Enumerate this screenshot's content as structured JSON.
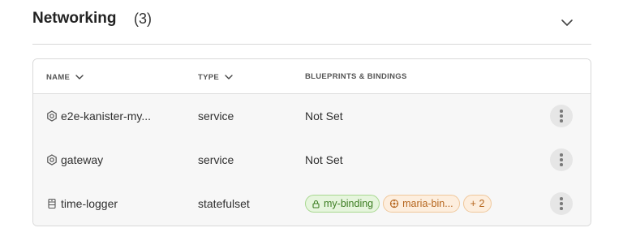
{
  "section": {
    "title": "Networking",
    "count": "(3)"
  },
  "table": {
    "columns": {
      "name": "NAME",
      "type": "TYPE",
      "blueprints": "BLUEPRINTS & BINDINGS"
    },
    "rows": [
      {
        "name": "e2e-kanister-my...",
        "type": "service",
        "blueprints": "Not Set",
        "icon": "service-icon"
      },
      {
        "name": "gateway",
        "type": "service",
        "blueprints": "Not Set",
        "icon": "service-icon"
      },
      {
        "name": "time-logger",
        "type": "statefulset",
        "icon": "statefulset-icon",
        "tags": [
          {
            "label": "my-binding",
            "icon": "lock-icon"
          },
          {
            "label": "maria-bin...",
            "icon": "blueprint-icon"
          },
          {
            "label": "+ 2"
          }
        ]
      }
    ]
  },
  "colors": {
    "green_tag_bg": "#e6f5dd",
    "green_tag_text": "#3c7d22",
    "orange_tag_bg": "#fdeede",
    "orange_tag_text": "#b5651d",
    "body_bg": "#f7f7f7"
  }
}
